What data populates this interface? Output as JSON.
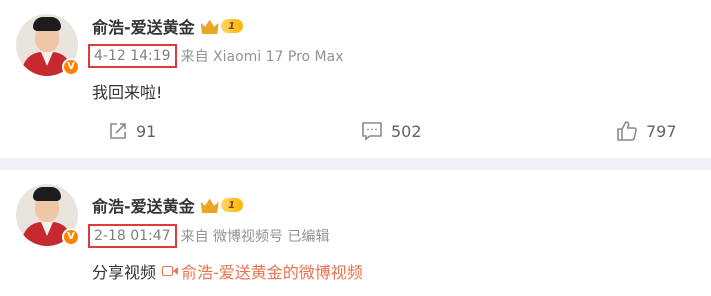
{
  "posts": [
    {
      "author": "俞浩-爱送黄金",
      "vip_level": "1",
      "verified_badge": "V",
      "time": "4-12 14:19",
      "source": "来自 Xiaomi 17 Pro Max",
      "content": "我回来啦!",
      "actions": {
        "share_count": "91",
        "comment_count": "502",
        "like_count": "797"
      }
    },
    {
      "author": "俞浩-爱送黄金",
      "vip_level": "1",
      "verified_badge": "V",
      "time": "2-18 01:47",
      "source": "来自 微博视频号 已编辑",
      "content": "分享视频",
      "link_text": "俞浩-爱送黄金的微博视频"
    }
  ],
  "colors": {
    "highlight_box": "#e03a3e",
    "link": "#eb7350",
    "verified": "#ff8200",
    "divider": "#f1f2f5"
  },
  "icons": [
    "verified-icon",
    "vip-crown-icon",
    "share-icon",
    "comment-icon",
    "like-icon",
    "video-icon"
  ]
}
